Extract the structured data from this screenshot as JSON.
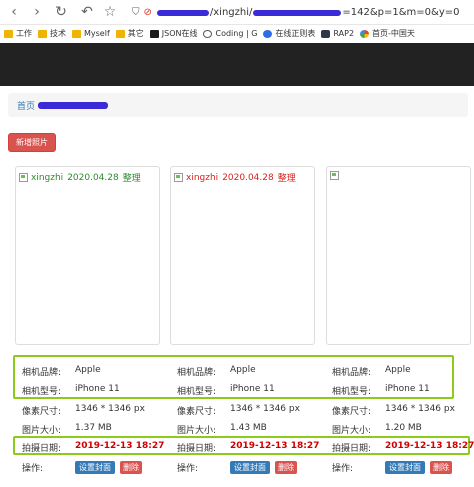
{
  "browser": {
    "address_host_suffix": "/xingzhi/",
    "address_query": "=142&p=1&m=0&y=0"
  },
  "bookmarks": [
    {
      "label": "工作",
      "icon": "folder-icon"
    },
    {
      "label": "技术",
      "icon": "folder-icon"
    },
    {
      "label": "Myself",
      "icon": "folder-icon"
    },
    {
      "label": "其它",
      "icon": "folder-icon"
    },
    {
      "label": "JSON在线",
      "icon": "json-icon"
    },
    {
      "label": "Coding | G",
      "icon": "coding-icon"
    },
    {
      "label": "在线正则表",
      "icon": "c-icon"
    },
    {
      "label": "RAP2",
      "icon": "rap-icon"
    },
    {
      "label": "首页-中国天",
      "icon": "g-icon"
    }
  ],
  "breadcrumb": {
    "home": "首页"
  },
  "actions": {
    "add_photo": "新增照片"
  },
  "cards": [
    {
      "user": "xingzhi",
      "date": "2020.04.28",
      "tag": "整理",
      "color": "#2e8b2e",
      "show_caption": true
    },
    {
      "user": "xingzhi",
      "date": "2020.04.28",
      "tag": "整理",
      "color": "#d9231e",
      "show_caption": true
    },
    {
      "user": "",
      "date": "",
      "tag": "",
      "color": "#333333",
      "show_caption": false
    }
  ],
  "labels": {
    "brand": "相机品牌:",
    "model": "相机型号:",
    "pixels": "像素尺寸:",
    "size": "图片大小:",
    "date": "拍摄日期:",
    "ops": "操作:",
    "set_cover": "设置封面",
    "delete": "删除"
  },
  "photos": [
    {
      "brand": "Apple",
      "model": "iPhone 11",
      "pixels": "1346 * 1346 px",
      "size": "1.37 MB",
      "date": "2019-12-13 18:27"
    },
    {
      "brand": "Apple",
      "model": "iPhone 11",
      "pixels": "1346 * 1346 px",
      "size": "1.43 MB",
      "date": "2019-12-13 18:27"
    },
    {
      "brand": "Apple",
      "model": "iPhone 11",
      "pixels": "1346 * 1346 px",
      "size": "1.20 MB",
      "date": "2019-12-13 18:27"
    }
  ],
  "colors": {
    "highlight": "#8ccb1a",
    "danger": "#d9534f",
    "primary": "#337ab7",
    "date_red": "#d00000"
  }
}
